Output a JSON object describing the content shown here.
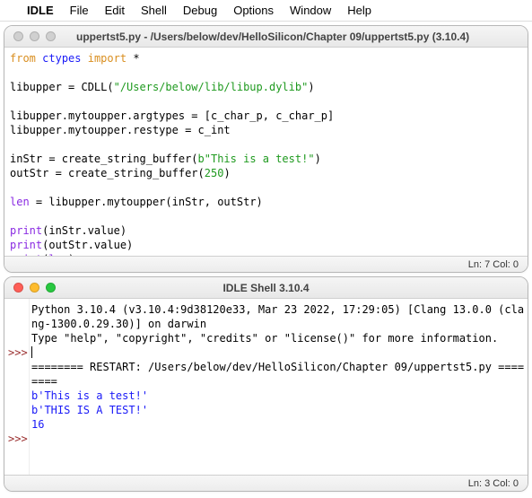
{
  "menubar": {
    "apple": "",
    "app": "IDLE",
    "items": [
      "File",
      "Edit",
      "Shell",
      "Debug",
      "Options",
      "Window",
      "Help"
    ]
  },
  "editor": {
    "title": "uppertst5.py - /Users/below/dev/HelloSilicon/Chapter 09/uppertst5.py (3.10.4)",
    "status": "Ln: 7  Col: 0",
    "code": {
      "l1_from": "from",
      "l1_ctypes": "ctypes",
      "l1_import": "import",
      "l1_star": " *",
      "l3a": "libupper = CDLL(",
      "l3s": "\"/Users/below/lib/libup.dylib\"",
      "l3b": ")",
      "l5": "libupper.mytoupper.argtypes = [c_char_p, c_char_p]",
      "l6": "libupper.mytoupper.restype = c_int",
      "l8a": "inStr = create_string_buffer(",
      "l8s": "b\"This is a test!\"",
      "l8b": ")",
      "l9a": "outStr = create_string_buffer(",
      "l9n": "250",
      "l9b": ")",
      "l11_len": "len",
      "l11_rest": " = libupper.mytoupper(inStr, outStr)",
      "l13_print": "print",
      "l13_rest": "(inStr.value)",
      "l14_print": "print",
      "l14_rest": "(outStr.value)",
      "l15_print": "print",
      "l15_open": "(",
      "l15_len": "len",
      "l15_close": ")"
    }
  },
  "shell": {
    "title": "IDLE Shell 3.10.4",
    "status": "Ln: 3  Col: 0",
    "prompt1": ">>>",
    "prompt2": ">>>",
    "banner1": "Python 3.10.4 (v3.10.4:9d38120e33, Mar 23 2022, 17:29:05) [Clang 13.0.0 (cla",
    "banner2": "ng-1300.0.29.30)] on darwin",
    "banner3": "Type \"help\", \"copyright\", \"credits\" or \"license()\" for more information.",
    "restart": "======== RESTART: /Users/below/dev/HelloSilicon/Chapter 09/uppertst5.py ====",
    "restart2": "====",
    "out1": "b'This is a test!'",
    "out2": "b'THIS IS A TEST!'",
    "out3": "16"
  }
}
